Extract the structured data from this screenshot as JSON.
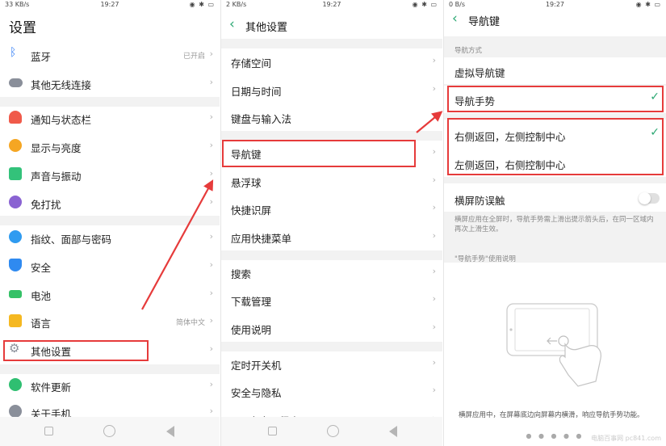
{
  "status": [
    {
      "left": "33 KB/s",
      "time": "19:27",
      "right": "◉ ✱ ▭"
    },
    {
      "left": "2 KB/s",
      "time": "19:27",
      "right": "◉ ✱ ▭"
    },
    {
      "left": "0 B/s",
      "time": "19:27",
      "right": "◉ ✱ ▭"
    }
  ],
  "panel1": {
    "title": "设置",
    "items": [
      {
        "label": "蓝牙",
        "value": "已开启",
        "icon": "bluetooth-icon",
        "color": "#2f7cf6"
      },
      {
        "label": "其他无线连接",
        "value": "",
        "icon": "wireless-icon",
        "color": "#8a8f9a"
      },
      {
        "label": "通知与状态栏",
        "value": "",
        "icon": "bell-icon",
        "color": "#f05a4a"
      },
      {
        "label": "显示与亮度",
        "value": "",
        "icon": "brightness-icon",
        "color": "#f5a623"
      },
      {
        "label": "声音与振动",
        "value": "",
        "icon": "speaker-icon",
        "color": "#33c27a"
      },
      {
        "label": "免打扰",
        "value": "",
        "icon": "moon-icon",
        "color": "#8a63d2"
      },
      {
        "label": "指纹、面部与密码",
        "value": "",
        "icon": "fingerprint-icon",
        "color": "#2f9bf0"
      },
      {
        "label": "安全",
        "value": "",
        "icon": "shield-icon",
        "color": "#2f8af0"
      },
      {
        "label": "电池",
        "value": "",
        "icon": "battery-icon",
        "color": "#35c167"
      },
      {
        "label": "语言",
        "value": "简体中文",
        "icon": "language-icon",
        "color": "#f5b821"
      },
      {
        "label": "其他设置",
        "value": "",
        "icon": "gear-icon",
        "color": "#8a8f9a"
      },
      {
        "label": "软件更新",
        "value": "",
        "icon": "update-icon",
        "color": "#2fbf71"
      },
      {
        "label": "关于手机",
        "value": "",
        "icon": "info-icon",
        "color": "#8a8f9a"
      }
    ]
  },
  "panel2": {
    "title": "其他设置",
    "items": [
      {
        "label": "存储空间"
      },
      {
        "label": "日期与时间"
      },
      {
        "label": "键盘与输入法"
      },
      {
        "label": "导航键"
      },
      {
        "label": "悬浮球"
      },
      {
        "label": "快捷识屏"
      },
      {
        "label": "应用快捷菜单"
      },
      {
        "label": "搜索"
      },
      {
        "label": "下载管理"
      },
      {
        "label": "使用说明"
      },
      {
        "label": "定时开关机"
      },
      {
        "label": "安全与隐私"
      },
      {
        "label": "SIM卡应用程序"
      }
    ]
  },
  "panel3": {
    "title": "导航键",
    "section_label": "导航方式",
    "options": [
      {
        "label": "虚拟导航键",
        "checked": false
      },
      {
        "label": "导航手势",
        "checked": true
      },
      {
        "label": "右侧返回，左侧控制中心",
        "checked": true
      },
      {
        "label": "左侧返回，右侧控制中心",
        "checked": false
      }
    ],
    "toggle_label": "横屏防误触",
    "toggle_on": false,
    "toggle_desc": "横屏应用在全屏时，导航手势需上滑出提示箭头后，在同一区域内再次上滑生效。",
    "guide_label": "\"导航手势\"使用说明",
    "guide_caption": "横屏应用中，在屏幕底边向屏幕内横滑，响应导航手势功能。",
    "page_dots": "● ● ● ● ●",
    "watermark": "电脑百事网 pc841.com"
  },
  "colors": {
    "accent": "#2aa772",
    "highlight": "#e63b3b"
  }
}
